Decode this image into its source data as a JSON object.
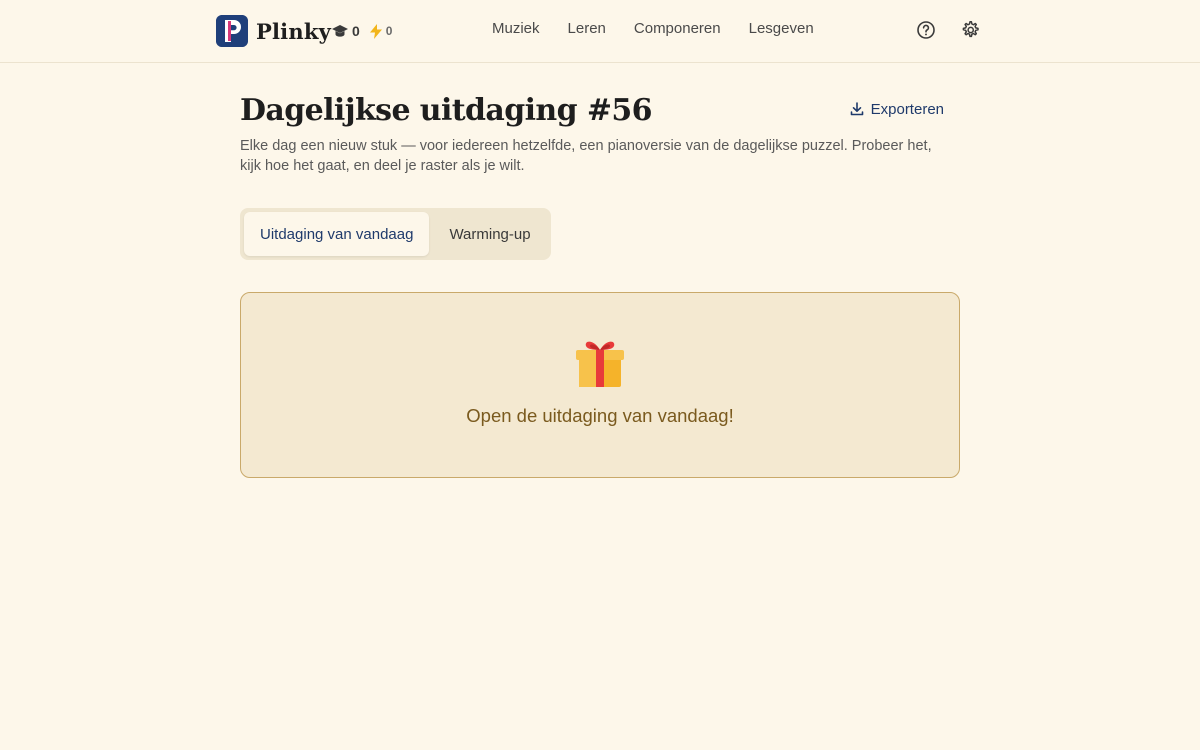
{
  "app": {
    "name": "Plinky",
    "logo_letter": "P"
  },
  "stats": {
    "xp_icon": "graduation-cap-icon",
    "xp": "0",
    "streak_icon": "lightning-icon",
    "streak": "0"
  },
  "nav": {
    "items": [
      {
        "label": "Muziek"
      },
      {
        "label": "Leren"
      },
      {
        "label": "Componeren"
      },
      {
        "label": "Lesgeven"
      }
    ]
  },
  "header_icons": [
    "help-icon",
    "gear-icon"
  ],
  "page": {
    "title": "Dagelijkse uitdaging #56",
    "description": "Elke dag een nieuw stuk — voor iedereen hetzelfde, een pianoversie van de dagelijkse puzzel. Probeer het, kijk hoe het gaat, en deel je raster als je wilt.",
    "export_label": "Exporteren"
  },
  "tabs": [
    {
      "label": "Uitdaging van vandaag",
      "active": true
    },
    {
      "label": "Warming-up",
      "active": false
    }
  ],
  "challenge_card": {
    "icon": "gift-icon",
    "text": "Open de uitdaging van vandaag!"
  },
  "colors": {
    "background": "#fdf7ea",
    "brand": "#1f3f7a",
    "accent_pink": "#d6387a",
    "card_bg": "#f4e9d1",
    "card_border": "#c9a96a",
    "card_text": "#7a5a1e",
    "link": "#1f3a6b"
  }
}
